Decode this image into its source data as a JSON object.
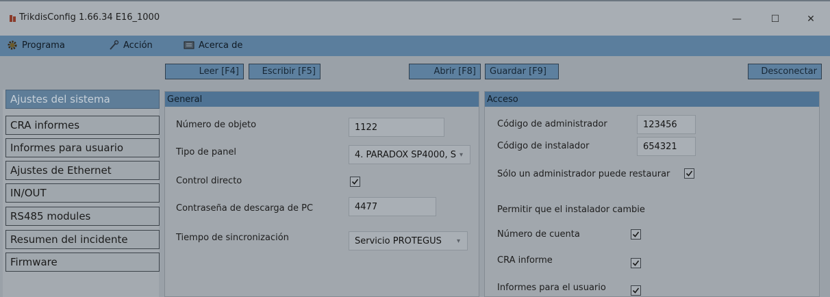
{
  "window": {
    "title": "TrikdisConfig 1.66.34   E16_1000",
    "minimize_glyph": "—",
    "maximize_glyph": "☐",
    "close_glyph": "✕"
  },
  "menu": {
    "items": [
      {
        "label": "Programa",
        "icon": "gear-icon"
      },
      {
        "label": "Acción",
        "icon": "wand-icon"
      },
      {
        "label": "Acerca de",
        "icon": "info-card-icon"
      }
    ]
  },
  "toolbar": {
    "read": "Leer [F4]",
    "write": "Escribir [F5]",
    "open": "Abrir [F8]",
    "save": "Guardar [F9]",
    "disconnect": "Desconectar"
  },
  "sidebar": {
    "items": [
      {
        "label": "Ajustes del sistema",
        "active": true
      },
      {
        "label": "CRA informes"
      },
      {
        "label": "Informes para usuario"
      },
      {
        "label": "Ajustes de Ethernet"
      },
      {
        "label": "IN/OUT"
      },
      {
        "label": "RS485 modules"
      },
      {
        "label": "Resumen del incidente"
      },
      {
        "label": "Firmware"
      }
    ]
  },
  "general": {
    "title": "General",
    "object_number_label": "Número de objeto",
    "object_number_value": "1122",
    "panel_type_label": "Tipo de panel",
    "panel_type_value": "4. PARADOX SP4000, S",
    "direct_control_label": "Control directo",
    "direct_control_checked": true,
    "pc_password_label": "Contraseña de descarga de PC",
    "pc_password_value": "4477",
    "sync_time_label": "Tiempo de sincronización",
    "sync_time_value": "Servicio PROTEGUS"
  },
  "access": {
    "title": "Acceso",
    "admin_code_label": "Código de administrador",
    "admin_code_value": "123456",
    "installer_code_label": "Código de instalador",
    "installer_code_value": "654321",
    "only_admin_restore_label": "Sólo un administrador puede restaurar",
    "allow_installer_change_label": "Permitir que el instalador cambie",
    "account_number_label": "Número de cuenta",
    "cra_report_label": "CRA informe",
    "user_reports_label": "Informes para el usuario"
  },
  "colors": {
    "menubar": "#5b7e9d",
    "panel_header": "#4f7394",
    "active_item": "#5e7d98"
  }
}
